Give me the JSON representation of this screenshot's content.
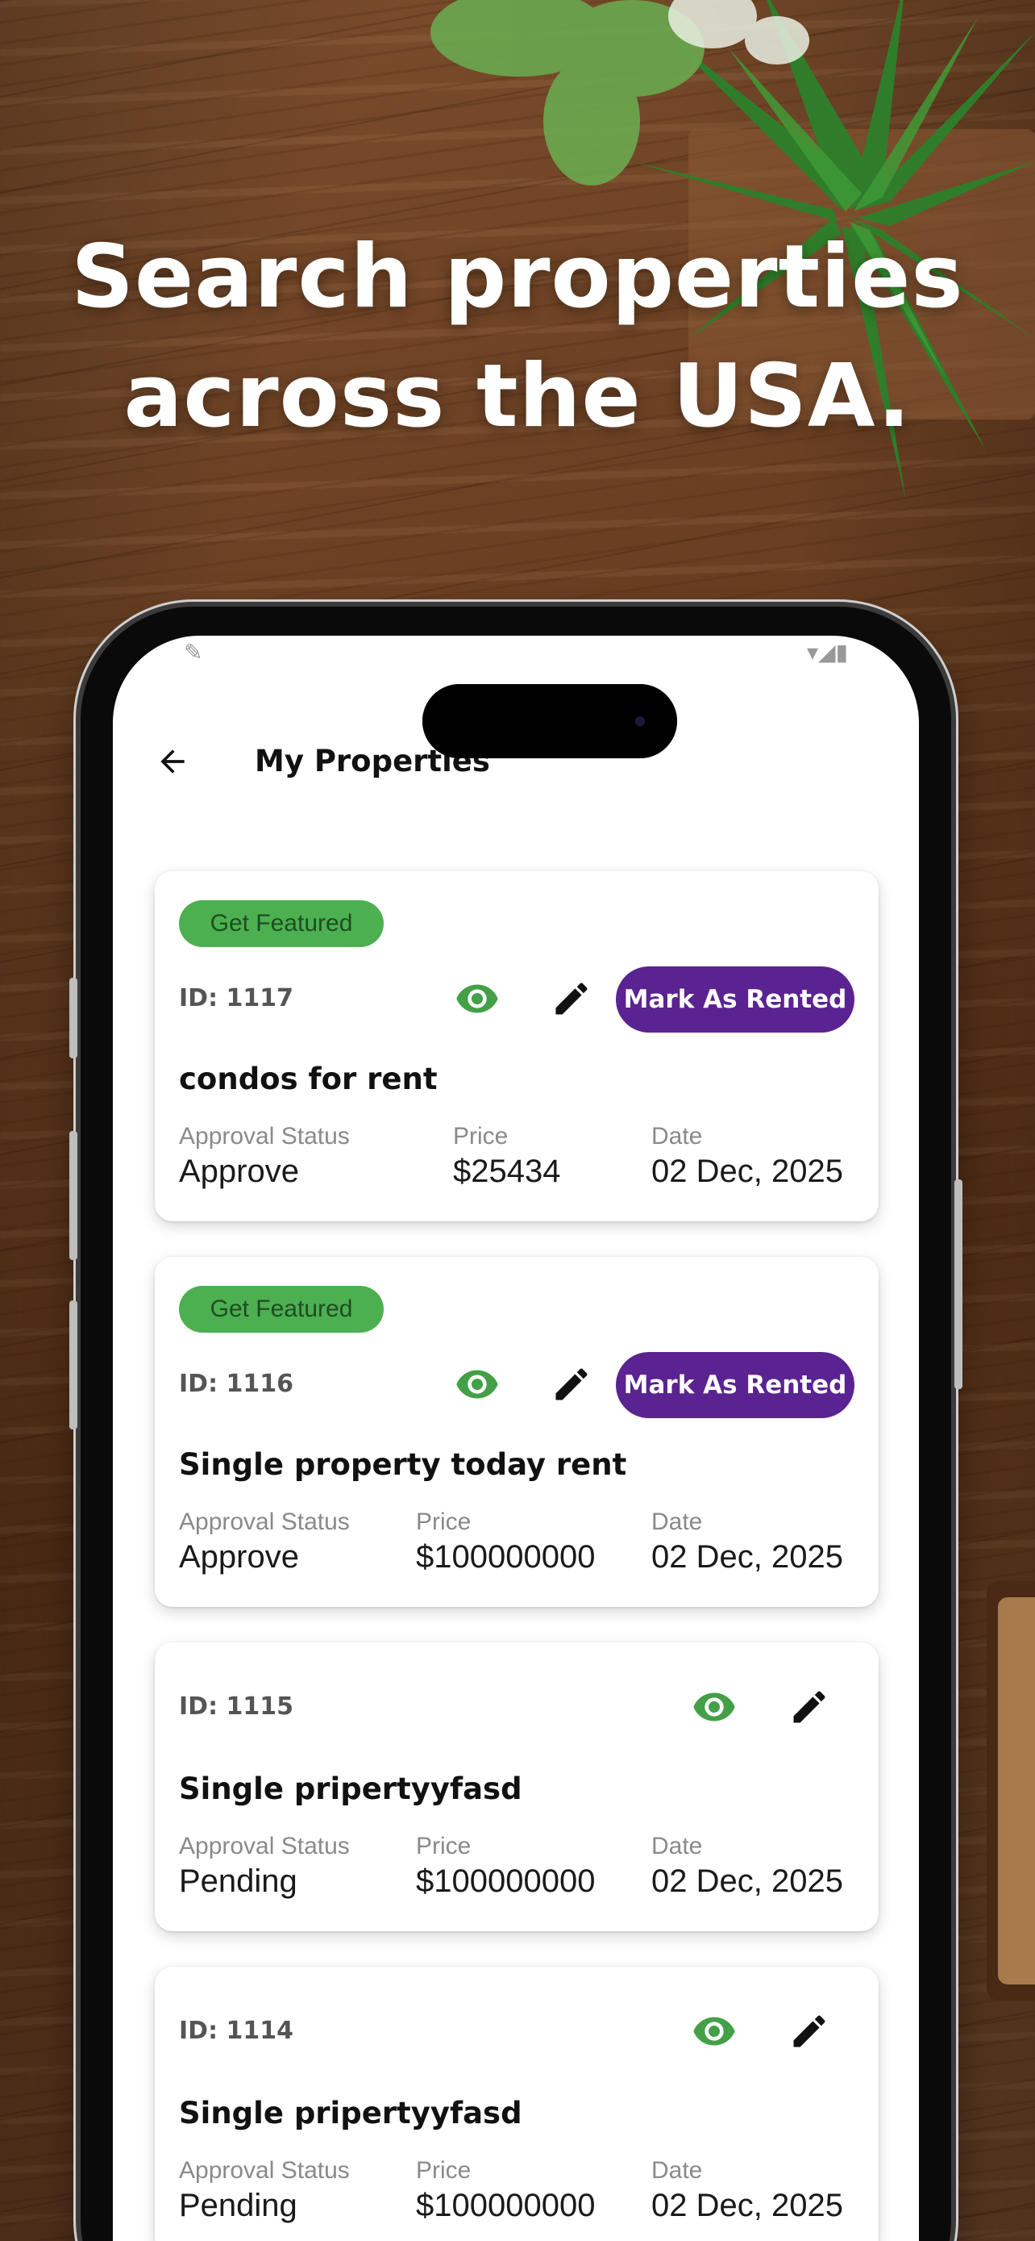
{
  "headline": {
    "line1": "Search properties",
    "line2": "across the USA."
  },
  "colors": {
    "featured_badge": "#4caf50",
    "rent_button": "#5a2391",
    "view_icon": "#43a047"
  },
  "app": {
    "title": "My Properties"
  },
  "labels": {
    "get_featured": "Get Featured",
    "mark_rented": "Mark As Rented",
    "approval_status": "Approval Status",
    "price": "Price",
    "date": "Date"
  },
  "properties": [
    {
      "id": "ID: 1117",
      "title": "condos for rent",
      "status": "Approve",
      "price": "$25434",
      "date": "02 Dec, 2025",
      "featured": true
    },
    {
      "id": "ID: 1116",
      "title": "Single property today rent",
      "status": "Approve",
      "price": "$100000000",
      "date": "02 Dec, 2025",
      "featured": true
    },
    {
      "id": "ID: 1115",
      "title": "Single pripertyyfasd",
      "status": "Pending",
      "price": "$100000000",
      "date": "02 Dec, 2025",
      "featured": false
    },
    {
      "id": "ID: 1114",
      "title": "Single pripertyyfasd",
      "status": "Pending",
      "price": "$100000000",
      "date": "02 Dec, 2025",
      "featured": false
    }
  ],
  "icons": {
    "back": "arrow-left-icon",
    "view": "eye-icon",
    "edit": "pencil-icon"
  }
}
